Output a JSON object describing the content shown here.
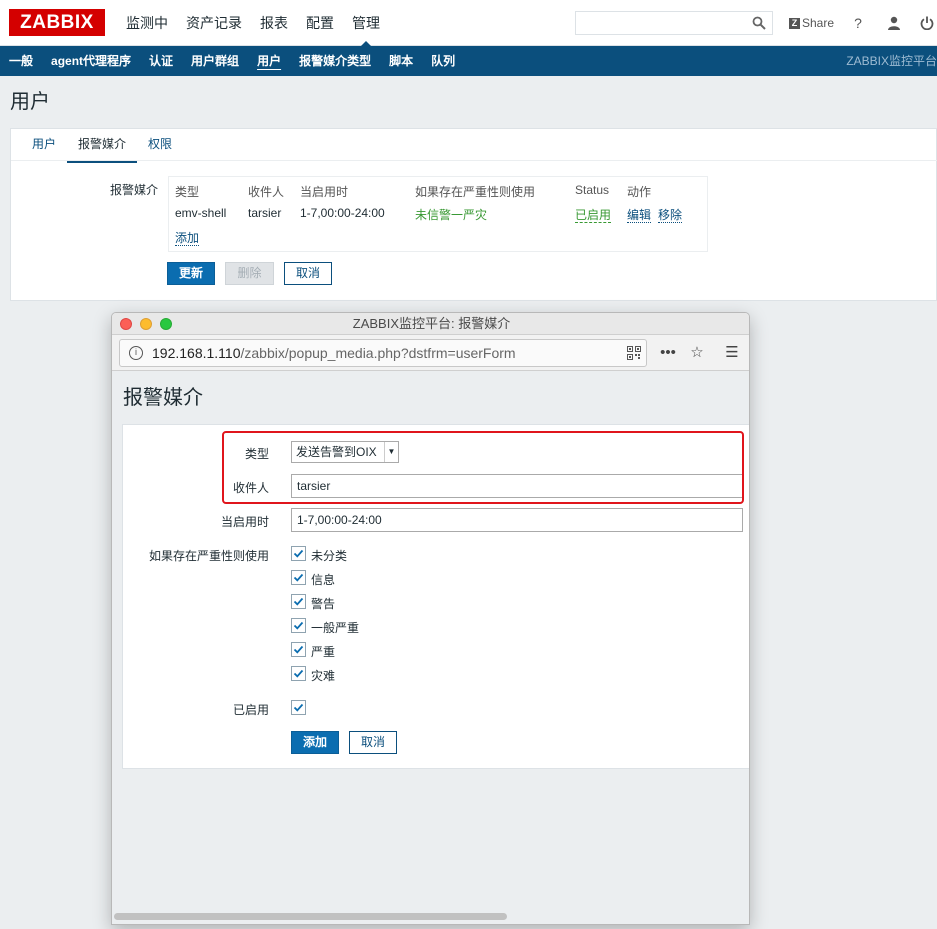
{
  "header": {
    "logo": "ZABBIX",
    "nav": [
      "监测中",
      "资产记录",
      "报表",
      "配置",
      "管理"
    ],
    "share": "Share",
    "help": "?",
    "subnav": [
      "一般",
      "agent代理程序",
      "认证",
      "用户群组",
      "用户",
      "报警媒介类型",
      "脚本",
      "队列"
    ],
    "subnav_right": "ZABBIX监控平台",
    "icons": [
      "search-icon",
      "user-icon",
      "power-icon"
    ]
  },
  "page": {
    "title": "用户",
    "tabs": [
      "用户",
      "报警媒介",
      "权限"
    ],
    "media_label": "报警媒介",
    "table": {
      "headers": [
        "类型",
        "收件人",
        "当启用时",
        "如果存在严重性则使用",
        "Status",
        "动作"
      ],
      "row": {
        "type": "emv-shell",
        "recipient": "tarsier",
        "when": "1-7,00:00-24:00",
        "severity": "未信警一严灾",
        "status": "已启用",
        "edit": "编辑",
        "remove": "移除"
      },
      "add_link": "添加"
    },
    "buttons": {
      "update": "更新",
      "delete": "删除",
      "cancel": "取消"
    }
  },
  "popup": {
    "window_title": "ZABBIX监控平台: 报警媒介",
    "url_host": "192.168.1.110",
    "url_path": "/zabbix/popup_media.php?dstfrm=userForm",
    "title": "报警媒介",
    "form": {
      "type_label": "类型",
      "type_value": "发送告警到OIX",
      "recipient_label": "收件人",
      "recipient_value": "tarsier",
      "when_label": "当启用时",
      "when_value": "1-7,00:00-24:00",
      "severity_label": "如果存在严重性则使用",
      "severities": [
        "未分类",
        "信息",
        "警告",
        "一般严重",
        "严重",
        "灾难"
      ],
      "enabled_label": "已启用"
    },
    "buttons": {
      "add": "添加",
      "cancel": "取消"
    },
    "colors": {
      "highlight_box": "#e0151c"
    }
  }
}
